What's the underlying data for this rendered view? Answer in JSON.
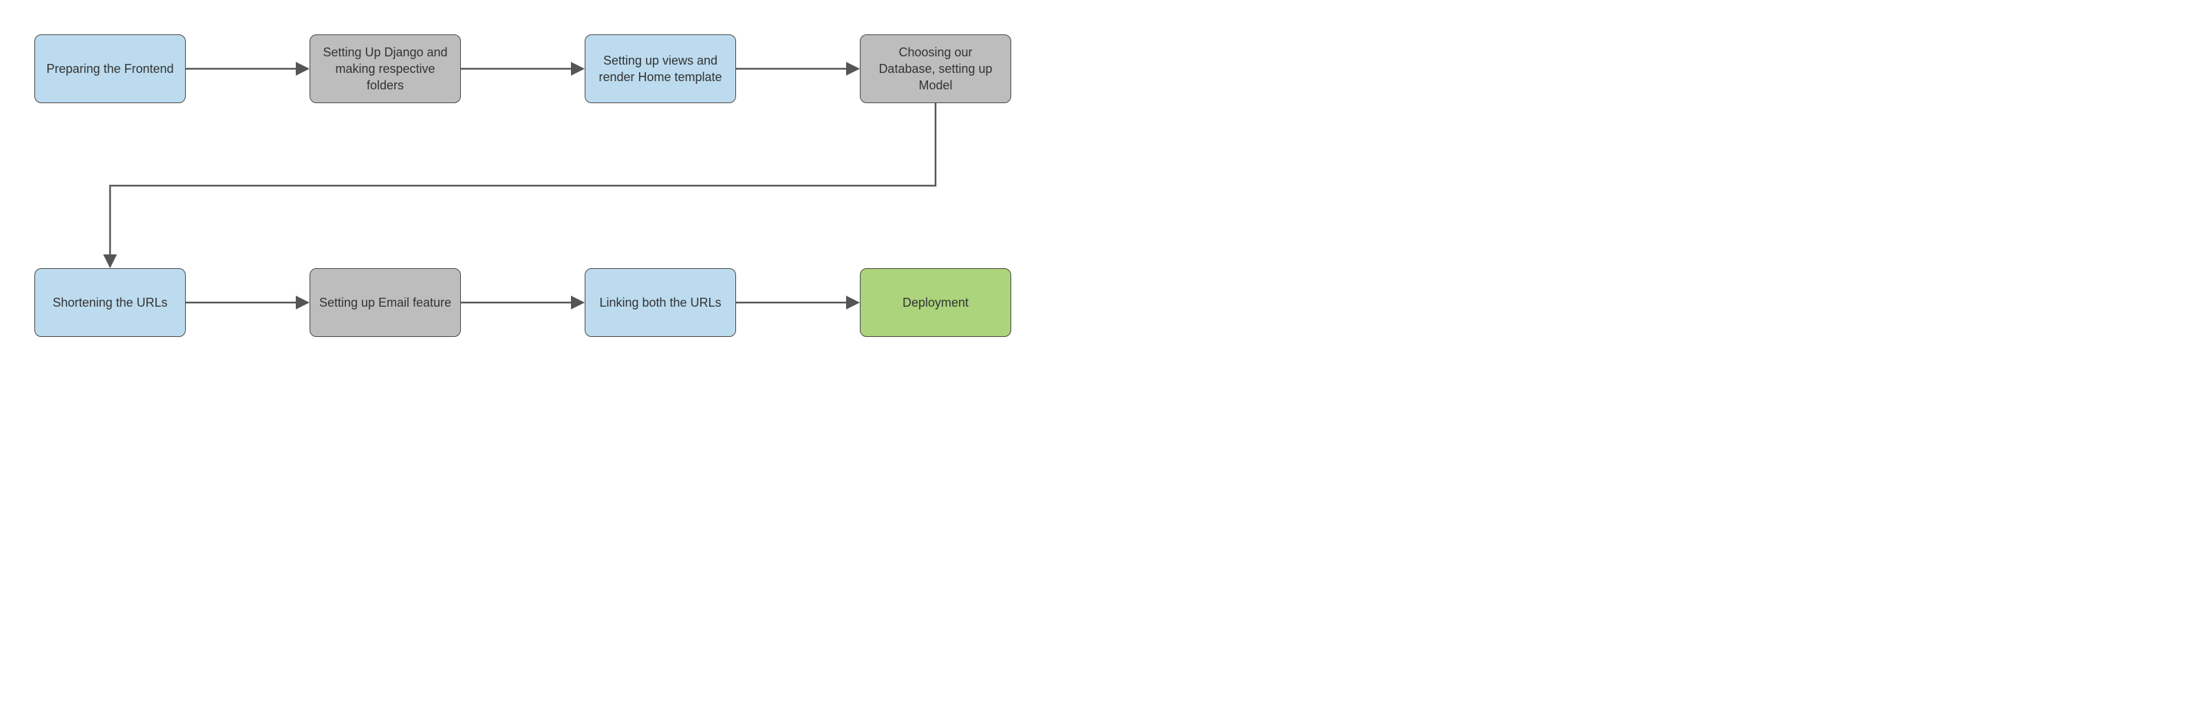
{
  "diagram": {
    "type": "flowchart",
    "nodes": [
      {
        "id": "n1",
        "label": "Preparing the Frontend",
        "row": 0,
        "col": 0,
        "color": "blue"
      },
      {
        "id": "n2",
        "label": "Setting Up Django and making respective folders",
        "row": 0,
        "col": 1,
        "color": "grey"
      },
      {
        "id": "n3",
        "label": "Setting up views and render Home template",
        "row": 0,
        "col": 2,
        "color": "blue"
      },
      {
        "id": "n4",
        "label": "Choosing our Database, setting up Model",
        "row": 0,
        "col": 3,
        "color": "grey"
      },
      {
        "id": "n5",
        "label": "Shortening the URLs",
        "row": 1,
        "col": 0,
        "color": "blue"
      },
      {
        "id": "n6",
        "label": "Setting up Email feature",
        "row": 1,
        "col": 1,
        "color": "grey"
      },
      {
        "id": "n7",
        "label": "Linking both the URLs",
        "row": 1,
        "col": 2,
        "color": "blue"
      },
      {
        "id": "n8",
        "label": "Deployment",
        "row": 1,
        "col": 3,
        "color": "green"
      }
    ],
    "edges": [
      {
        "from": "n1",
        "to": "n2"
      },
      {
        "from": "n2",
        "to": "n3"
      },
      {
        "from": "n3",
        "to": "n4"
      },
      {
        "from": "n4",
        "to": "n5"
      },
      {
        "from": "n5",
        "to": "n6"
      },
      {
        "from": "n6",
        "to": "n7"
      },
      {
        "from": "n7",
        "to": "n8"
      }
    ],
    "colors": {
      "blue": "#bcdbee",
      "grey": "#bdbdbd",
      "green": "#abd47c",
      "stroke": "#555555"
    }
  }
}
